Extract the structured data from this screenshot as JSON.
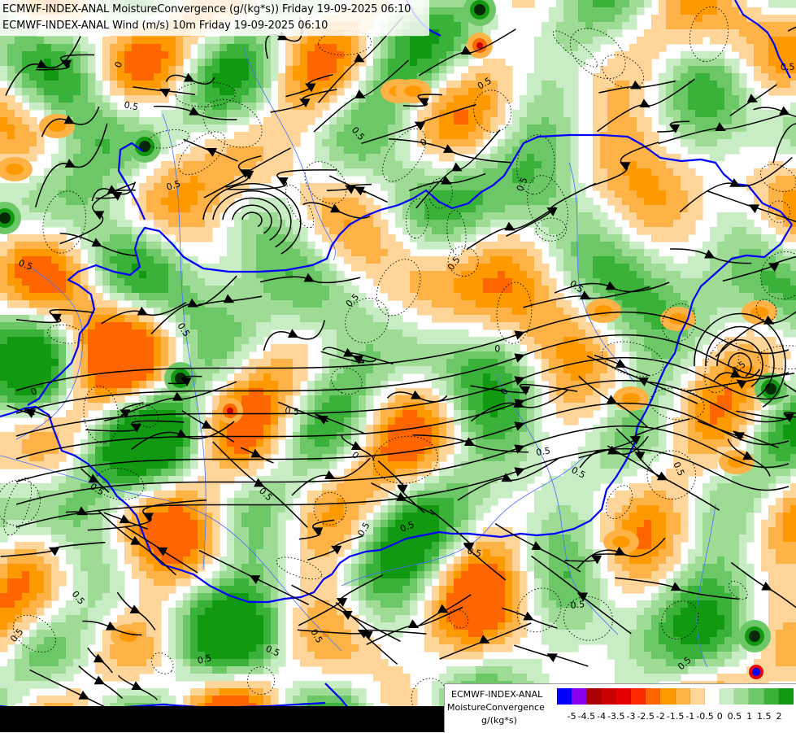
{
  "titles": {
    "line1": "ECMWF-INDEX-ANAL MoistureConvergence (g/(kg*s)) Friday 19-09-2025 06:10",
    "line2": "ECMWF-INDEX-ANAL Wind (m/s) 10m Friday 19-09-2025 06:10"
  },
  "legend": {
    "line1": "ECMWF-INDEX-ANAL",
    "line2": "MoistureConvergence",
    "line3": "g/(kg*s)",
    "colors": [
      "#0000ff",
      "#8800ee",
      "#aa0000",
      "#cc0000",
      "#e60000",
      "#ff2a00",
      "#ff6600",
      "#ff9900",
      "#ffb347",
      "#ffd59a",
      "#ffffff",
      "#c8ecc4",
      "#9edc96",
      "#6cc866",
      "#3ab23a",
      "#119911"
    ],
    "ticks": [
      "-5",
      "-4.5",
      "-4",
      "-3.5",
      "-3",
      "-2.5",
      "-2",
      "-1.5",
      "-1",
      "-0.5",
      "0",
      "0.5",
      "1",
      "1.5",
      "2"
    ]
  },
  "map": {
    "contour_labels": [
      "0",
      "0",
      "0",
      "0",
      "0",
      "0",
      "0.5",
      "0.5",
      "0.5",
      "0.5",
      "0.5",
      "0.5",
      "0.5",
      "0.5",
      "0.5",
      "0.5",
      "0.5",
      "0.5",
      "0.5",
      "0.5",
      "0.5",
      "0.5",
      "0.5",
      "0.5",
      "0.5",
      "0.5",
      "0.5",
      "0.5",
      "0.5",
      "0.5",
      "0.5",
      "0.5",
      "0.5",
      "0.5"
    ],
    "colors": {
      "border": "#0000ff",
      "river": "#4a6cff",
      "streamline": "#000000",
      "water": "#ffffff"
    }
  }
}
